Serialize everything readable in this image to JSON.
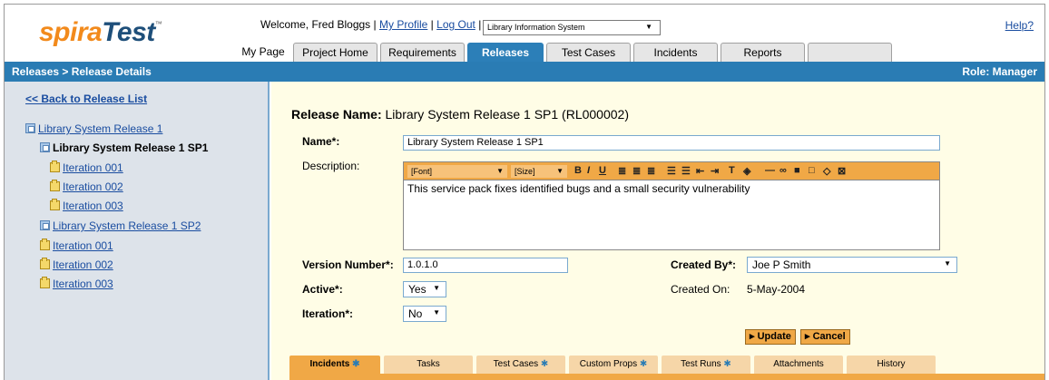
{
  "app": {
    "logo_part1": "spira",
    "logo_part2": "Test",
    "logo_tm": "™",
    "help": "Help?"
  },
  "header": {
    "welcome": "Welcome, Fred Bloggs",
    "sep1": "|",
    "my_profile": "My Profile",
    "sep2": "|",
    "log_out": "Log Out",
    "sep3": "|",
    "project": "Library Information System"
  },
  "tabs": [
    {
      "label": "My Page"
    },
    {
      "label": "Project Home"
    },
    {
      "label": "Requirements"
    },
    {
      "label": "Releases"
    },
    {
      "label": "Test Cases"
    },
    {
      "label": "Incidents"
    },
    {
      "label": "Reports"
    }
  ],
  "titlebar": {
    "breadcrumb": "Releases > Release Details",
    "role": "Role: Manager"
  },
  "sidebar": {
    "back": "<< Back to Release List",
    "tree": [
      {
        "label": "Library System Release 1",
        "type": "release"
      },
      {
        "label": "Library System Release 1 SP1",
        "type": "release"
      },
      {
        "label": "Iteration 001",
        "type": "iteration"
      },
      {
        "label": "Iteration 002",
        "type": "iteration"
      },
      {
        "label": "Iteration 003",
        "type": "iteration"
      },
      {
        "label": "Library System Release 1 SP2",
        "type": "release"
      },
      {
        "label": "Iteration 001",
        "type": "iteration"
      },
      {
        "label": "Iteration 002",
        "type": "iteration"
      },
      {
        "label": "Iteration 003",
        "type": "iteration"
      }
    ]
  },
  "form": {
    "title_label": "Release Name:",
    "title_value": "Library System Release 1 SP1 (RL000002)",
    "name_label": "Name*:",
    "name_value": "Library System Release 1 SP1",
    "description_label": "Description:",
    "font_select": "[Font]",
    "size_select": "[Size]",
    "description_value": "This service pack fixes identified bugs and a small security vulnerability",
    "version_label": "Version Number*:",
    "version_value": "1.0.1.0",
    "active_label": "Active*:",
    "active_value": "Yes",
    "iteration_label": "Iteration*:",
    "iteration_value": "No",
    "created_by_label": "Created By*:",
    "created_by_value": "Joe P Smith",
    "created_on_label": "Created On:",
    "created_on_value": "5-May-2004",
    "update": "▸ Update",
    "cancel": "▸ Cancel"
  },
  "subtabs": [
    {
      "label": "Incidents",
      "star": "✱"
    },
    {
      "label": "Tasks",
      "star": ""
    },
    {
      "label": "Test Cases",
      "star": "✱"
    },
    {
      "label": "Custom Props",
      "star": "✱"
    },
    {
      "label": "Test Runs",
      "star": "✱"
    },
    {
      "label": "Attachments",
      "star": ""
    },
    {
      "label": "History",
      "star": ""
    }
  ],
  "colors": {
    "accent": "#2a7cb4",
    "orange": "#f0a846",
    "main_bg": "#fffde6",
    "sidebar_bg": "#dde3ea"
  }
}
